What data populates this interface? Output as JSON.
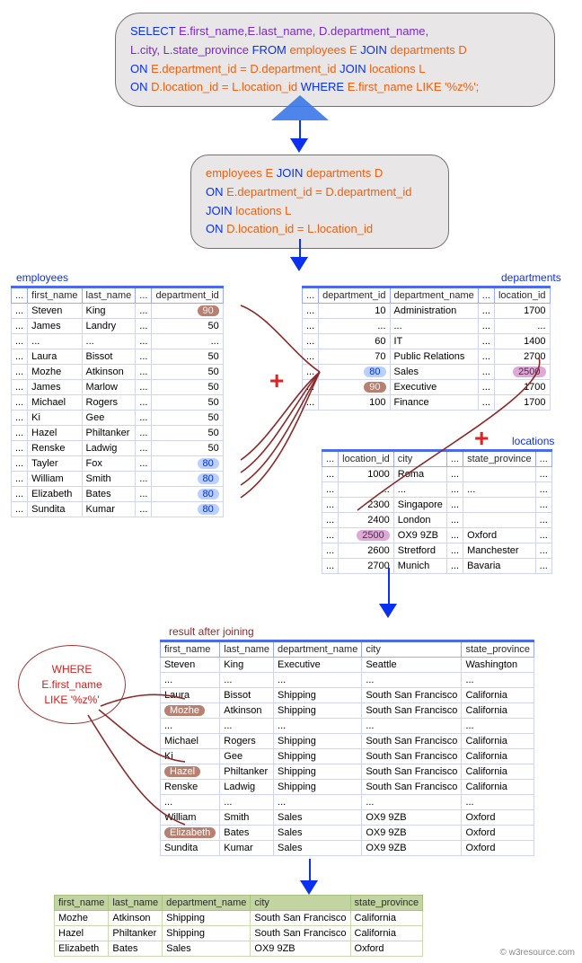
{
  "sql": {
    "line1a": "SELECT ",
    "line1b": "E.first_name,E.last_name, D.department_name,",
    "line2a": "L.city, L.state_province ",
    "line2b": "FROM ",
    "line2c": "employees E ",
    "line2d": "JOIN ",
    "line2e": "departments D",
    "line3a": "ON ",
    "line3b": "E.department_id = D.department_id ",
    "line3c": "JOIN ",
    "line3d": "locations L",
    "line4a": "ON ",
    "line4b": "D.location_id = L.location_id ",
    "line4c": "WHERE ",
    "line4d": "E.first_name LIKE  '%z%';"
  },
  "joinbox": {
    "j1a": "employees E ",
    "j1b": "JOIN ",
    "j1c": "departments D",
    "j2a": "ON ",
    "j2b": "E.department_id = D.department_id",
    "j3a": "JOIN ",
    "j3b": "locations L",
    "j4a": "ON ",
    "j4b": "D.location_id = L.location_id"
  },
  "where": {
    "l1": "WHERE E.first_name",
    "l2": "LIKE  '%z%'"
  },
  "labels": {
    "employees": "employees",
    "departments": "departments",
    "locations": "locations",
    "resultjoin": "result after joining"
  },
  "employees": {
    "headers": [
      "...",
      "first_name",
      "last_name",
      "...",
      "department_id"
    ],
    "rows": [
      [
        "...",
        "Steven",
        "King",
        "...",
        "90"
      ],
      [
        "...",
        "James",
        "Landry",
        "...",
        "50"
      ],
      [
        "...",
        "...",
        "...",
        "...",
        "..."
      ],
      [
        "...",
        "Laura",
        "Bissot",
        "...",
        "50"
      ],
      [
        "...",
        "Mozhe",
        "Atkinson",
        "...",
        "50"
      ],
      [
        "...",
        "James",
        "Marlow",
        "...",
        "50"
      ],
      [
        "...",
        "Michael",
        "Rogers",
        "...",
        "50"
      ],
      [
        "...",
        "Ki",
        "Gee",
        "...",
        "50"
      ],
      [
        "...",
        "Hazel",
        "Philtanker",
        "...",
        "50"
      ],
      [
        "...",
        "Renske",
        "Ladwig",
        "...",
        "50"
      ],
      [
        "...",
        "Tayler",
        "Fox",
        "...",
        "80"
      ],
      [
        "...",
        "William",
        "Smith",
        "...",
        "80"
      ],
      [
        "...",
        "Elizabeth",
        "Bates",
        "...",
        "80"
      ],
      [
        "...",
        "Sundita",
        "Kumar",
        "...",
        "80"
      ]
    ],
    "hl": {
      "90": "brown",
      "80": "blue"
    }
  },
  "departments": {
    "headers": [
      "...",
      "department_id",
      "department_name",
      "...",
      "location_id"
    ],
    "rows": [
      [
        "...",
        "10",
        "Administration",
        "...",
        "1700"
      ],
      [
        "...",
        "...",
        "...",
        "...",
        "..."
      ],
      [
        "...",
        "60",
        "IT",
        "...",
        "1400"
      ],
      [
        "...",
        "70",
        "Public Relations",
        "...",
        "2700"
      ],
      [
        "...",
        "80",
        "Sales",
        "...",
        "2500"
      ],
      [
        "...",
        "90",
        "Executive",
        "...",
        "1700"
      ],
      [
        "...",
        "100",
        "Finance",
        "...",
        "1700"
      ]
    ]
  },
  "locations": {
    "headers": [
      "...",
      "location_id",
      "city",
      "...",
      "state_province",
      "..."
    ],
    "rows": [
      [
        "...",
        "1000",
        "Roma",
        "...",
        "",
        "..."
      ],
      [
        "...",
        "...",
        "...",
        "...",
        "...",
        "..."
      ],
      [
        "...",
        "2300",
        "Singapore",
        "...",
        "",
        "..."
      ],
      [
        "...",
        "2400",
        "London",
        "...",
        "",
        "..."
      ],
      [
        "...",
        "2500",
        "OX9 9ZB",
        "...",
        "Oxford",
        "..."
      ],
      [
        "...",
        "2600",
        "Stretford",
        "...",
        "Manchester",
        "..."
      ],
      [
        "...",
        "2700",
        "Munich",
        "...",
        "Bavaria",
        "..."
      ]
    ]
  },
  "joined": {
    "headers": [
      "first_name",
      "last_name",
      "department_name",
      "city",
      "state_province"
    ],
    "rows": [
      [
        "Steven",
        "King",
        "Executive",
        "Seattle",
        "Washington"
      ],
      [
        "...",
        "...",
        "...",
        "...",
        "..."
      ],
      [
        "Laura",
        "Bissot",
        "Shipping",
        "South San Francisco",
        "California"
      ],
      [
        "Mozhe",
        "Atkinson",
        "Shipping",
        "South San Francisco",
        "California"
      ],
      [
        "...",
        "...",
        "...",
        "...",
        "..."
      ],
      [
        "Michael",
        "Rogers",
        "Shipping",
        "South San Francisco",
        "California"
      ],
      [
        "Ki",
        "Gee",
        "Shipping",
        "South San Francisco",
        "California"
      ],
      [
        "Hazel",
        "Philtanker",
        "Shipping",
        "South San Francisco",
        "California"
      ],
      [
        "Renske",
        "Ladwig",
        "Shipping",
        "South San Francisco",
        "California"
      ],
      [
        "...",
        "...",
        "...",
        "...",
        "..."
      ],
      [
        "William",
        "Smith",
        "Sales",
        "OX9 9ZB",
        "Oxford"
      ],
      [
        "Elizabeth",
        "Bates",
        "Sales",
        "OX9 9ZB",
        "Oxford"
      ],
      [
        "Sundita",
        "Kumar",
        "Sales",
        "OX9 9ZB",
        "Oxford"
      ]
    ],
    "hlRows": [
      3,
      7,
      11
    ]
  },
  "final": {
    "headers": [
      "first_name",
      "last_name",
      "department_name",
      "city",
      "state_province"
    ],
    "rows": [
      [
        "Mozhe",
        "Atkinson",
        "Shipping",
        "South San Francisco",
        "California"
      ],
      [
        "Hazel",
        "Philtanker",
        "Shipping",
        "South San Francisco",
        "California"
      ],
      [
        "Elizabeth",
        "Bates",
        "Sales",
        "OX9 9ZB",
        "Oxford"
      ]
    ]
  },
  "watermark": "© w3resource.com"
}
